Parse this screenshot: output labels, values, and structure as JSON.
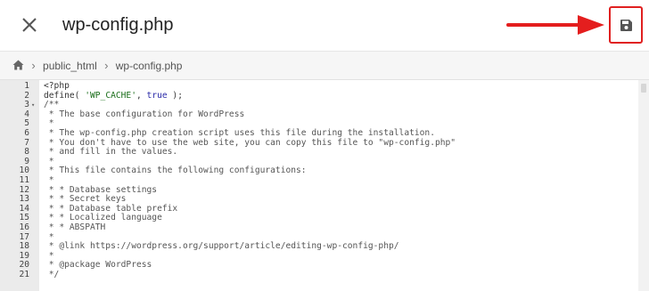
{
  "header": {
    "title": "wp-config.php",
    "close_icon": "close-icon",
    "save_icon": "floppy-disk-icon",
    "annotation_color": "#e41e1e"
  },
  "breadcrumb": {
    "home_icon": "home-icon",
    "items": [
      "public_html",
      "wp-config.php"
    ]
  },
  "editor": {
    "lines": [
      {
        "n": "1",
        "parts": [
          {
            "t": "<?php",
            "c": "pl"
          }
        ]
      },
      {
        "n": "2",
        "parts": [
          {
            "t": "define( ",
            "c": "pl"
          },
          {
            "t": "'WP_CACHE'",
            "c": "str"
          },
          {
            "t": ", ",
            "c": "pl"
          },
          {
            "t": "true",
            "c": "kw"
          },
          {
            "t": " );",
            "c": "pl"
          }
        ]
      },
      {
        "n": "3",
        "fold": true,
        "parts": [
          {
            "t": "/**",
            "c": "cm"
          }
        ]
      },
      {
        "n": "4",
        "parts": [
          {
            "t": " * The base configuration for WordPress",
            "c": "cm"
          }
        ]
      },
      {
        "n": "5",
        "parts": [
          {
            "t": " *",
            "c": "cm"
          }
        ]
      },
      {
        "n": "6",
        "parts": [
          {
            "t": " * The wp-config.php creation script uses this file during the installation.",
            "c": "cm"
          }
        ]
      },
      {
        "n": "7",
        "parts": [
          {
            "t": " * You don't have to use the web site, you can copy this file to \"wp-config.php\"",
            "c": "cm"
          }
        ]
      },
      {
        "n": "8",
        "parts": [
          {
            "t": " * and fill in the values.",
            "c": "cm"
          }
        ]
      },
      {
        "n": "9",
        "parts": [
          {
            "t": " *",
            "c": "cm"
          }
        ]
      },
      {
        "n": "10",
        "parts": [
          {
            "t": " * This file contains the following configurations:",
            "c": "cm"
          }
        ]
      },
      {
        "n": "11",
        "parts": [
          {
            "t": " *",
            "c": "cm"
          }
        ]
      },
      {
        "n": "12",
        "parts": [
          {
            "t": " * * Database settings",
            "c": "cm"
          }
        ]
      },
      {
        "n": "13",
        "parts": [
          {
            "t": " * * Secret keys",
            "c": "cm"
          }
        ]
      },
      {
        "n": "14",
        "parts": [
          {
            "t": " * * Database table prefix",
            "c": "cm"
          }
        ]
      },
      {
        "n": "15",
        "parts": [
          {
            "t": " * * Localized language",
            "c": "cm"
          }
        ]
      },
      {
        "n": "16",
        "parts": [
          {
            "t": " * * ABSPATH",
            "c": "cm"
          }
        ]
      },
      {
        "n": "17",
        "parts": [
          {
            "t": " *",
            "c": "cm"
          }
        ]
      },
      {
        "n": "18",
        "parts": [
          {
            "t": " * @link https://wordpress.org/support/article/editing-wp-config-php/",
            "c": "cm"
          }
        ]
      },
      {
        "n": "19",
        "parts": [
          {
            "t": " *",
            "c": "cm"
          }
        ]
      },
      {
        "n": "20",
        "parts": [
          {
            "t": " * @package WordPress",
            "c": "cm"
          }
        ]
      },
      {
        "n": "21",
        "parts": [
          {
            "t": " */",
            "c": "cm"
          }
        ]
      }
    ]
  }
}
